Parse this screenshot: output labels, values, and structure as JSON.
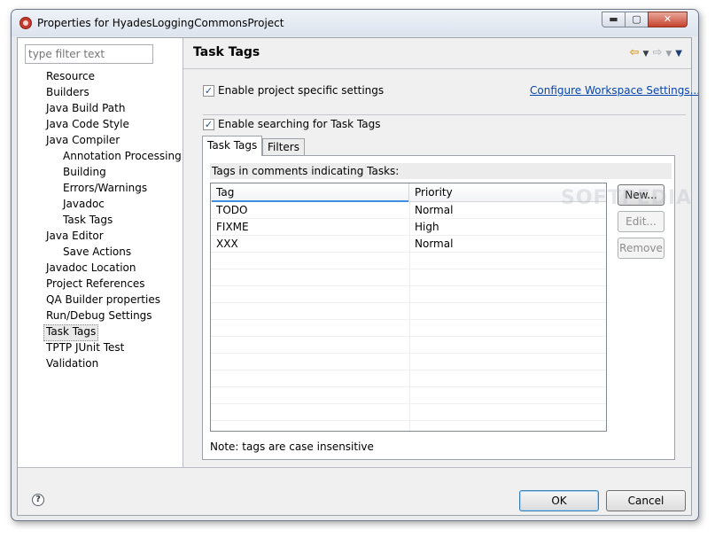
{
  "window": {
    "title": "Properties for HyadesLoggingCommonsProject",
    "min_glyph": "▬",
    "max_glyph": "▢",
    "close_glyph": "✕"
  },
  "filter": {
    "placeholder": "type filter text"
  },
  "tree": [
    {
      "label": "Resource",
      "level": 0
    },
    {
      "label": "Builders",
      "level": 0
    },
    {
      "label": "Java Build Path",
      "level": 0
    },
    {
      "label": "Java Code Style",
      "level": 0
    },
    {
      "label": "Java Compiler",
      "level": 0
    },
    {
      "label": "Annotation Processing",
      "level": 1
    },
    {
      "label": "Building",
      "level": 1
    },
    {
      "label": "Errors/Warnings",
      "level": 1
    },
    {
      "label": "Javadoc",
      "level": 1
    },
    {
      "label": "Task Tags",
      "level": 1
    },
    {
      "label": "Java Editor",
      "level": 0
    },
    {
      "label": "Save Actions",
      "level": 1
    },
    {
      "label": "Javadoc Location",
      "level": 0
    },
    {
      "label": "Project References",
      "level": 0
    },
    {
      "label": "QA Builder properties",
      "level": 0
    },
    {
      "label": "Run/Debug Settings",
      "level": 0
    },
    {
      "label": "Task Tags",
      "level": 0,
      "selected": true
    },
    {
      "label": "TPTP JUnit Test",
      "level": 0
    },
    {
      "label": "Validation",
      "level": 0
    }
  ],
  "page": {
    "title": "Task Tags",
    "enable_project_label": "Enable project specific settings",
    "enable_project_checked": true,
    "configure_link": "Configure Workspace Settings...",
    "enable_searching_label": "Enable searching for Task Tags",
    "enable_searching_checked": true,
    "tabs": [
      {
        "label": "Task Tags",
        "active": true
      },
      {
        "label": "Filters",
        "active": false
      }
    ],
    "tags_description": "Tags in comments indicating Tasks:",
    "table": {
      "columns": [
        "Tag",
        "Priority"
      ],
      "rows": [
        {
          "tag": "TODO",
          "priority": "Normal"
        },
        {
          "tag": "FIXME",
          "priority": "High"
        },
        {
          "tag": "XXX",
          "priority": "Normal"
        }
      ]
    },
    "buttons": {
      "new": "New...",
      "edit": "Edit...",
      "remove": "Remove"
    },
    "note": "Note: tags are case insensitive"
  },
  "footer": {
    "help_glyph": "?",
    "ok": "OK",
    "cancel": "Cancel"
  },
  "icons": {
    "back": "arrow-back-icon",
    "forward": "arrow-forward-icon",
    "view_menu": "view-menu-icon",
    "help": "help-icon"
  },
  "watermark": "SOFTPEDIA"
}
